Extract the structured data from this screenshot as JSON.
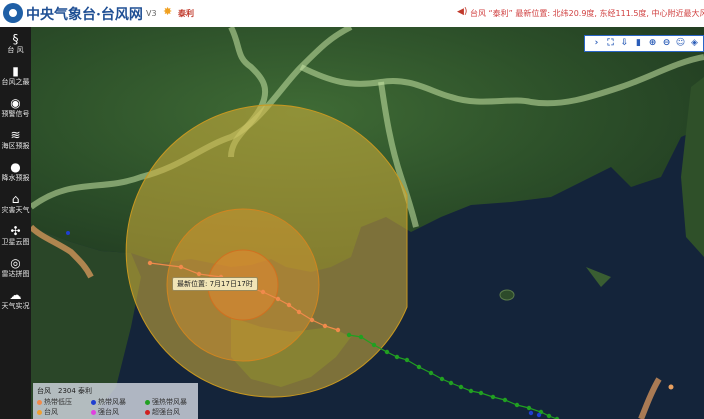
{
  "header": {
    "site_title": "中央气象台·台风网",
    "version": "V3",
    "current_typhoon": "泰利",
    "ticker": "台风 “泰利” 最新位置: 北纬20.9度, 东经111.5度, 中心附近最大风力"
  },
  "sidebar": {
    "items": [
      {
        "label": "台 风",
        "icon": "typhoon-icon",
        "glyph": "§"
      },
      {
        "label": "台风之最",
        "icon": "bar-chart-icon",
        "glyph": "▮"
      },
      {
        "label": "预警信号",
        "icon": "signal-icon",
        "glyph": "◉"
      },
      {
        "label": "海区预报",
        "icon": "sea-icon",
        "glyph": "≋"
      },
      {
        "label": "降水预报",
        "icon": "rain-icon",
        "glyph": "●"
      },
      {
        "label": "灾害天气",
        "icon": "house-icon",
        "glyph": "⌂"
      },
      {
        "label": "卫星云图",
        "icon": "satellite-icon",
        "glyph": "✣"
      },
      {
        "label": "雷达拼图",
        "icon": "radar-icon",
        "glyph": "◎"
      },
      {
        "label": "天气实况",
        "icon": "cloud-icon",
        "glyph": "☁"
      }
    ]
  },
  "map": {
    "position_label": "最新位置: 7月17日17时",
    "colors": {
      "seven_level_circle": "#d4b13a",
      "ten_level_circle": "#f0a030",
      "track_past": "#f08a4b",
      "track_forecast": "#21a021"
    }
  },
  "toolbar": {
    "buttons": [
      "arrow-icon",
      "fullscreen-icon",
      "export-icon",
      "ruler-icon",
      "zoom-in-icon",
      "zoom-out-icon",
      "user-icon",
      "layers-icon"
    ]
  },
  "legend": {
    "title": "台风　2304 泰利",
    "items": [
      {
        "label": "热带低压",
        "color": "#f08a4b"
      },
      {
        "label": "热带风暴",
        "color": "#1f3fd0"
      },
      {
        "label": "强热带风暴",
        "color": "#21a021"
      },
      {
        "label": "台风",
        "color": "#f0a030"
      },
      {
        "label": "强台风",
        "color": "#e040e0"
      },
      {
        "label": "超强台风",
        "color": "#d02020"
      }
    ]
  }
}
